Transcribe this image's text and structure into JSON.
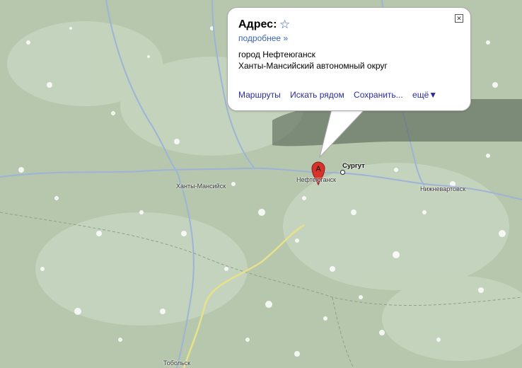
{
  "bubble": {
    "title": "Адрес:",
    "star_icon": "star-outline-icon",
    "more_link": "подробнее »",
    "address_line1": "город Нефтеюганск",
    "address_line2": "Ханты-Мансийский автономный округ",
    "links": [
      "Маршруты",
      "Искать рядом",
      "Сохранить...",
      "ещё▼"
    ],
    "close_icon": "close-icon"
  },
  "marker": {
    "label": "A",
    "color": "#d6332b"
  },
  "cities": {
    "khanty": "Ханты-Мансийск",
    "surgut": "Сургут",
    "nefte": "Нефтеюганск",
    "nizhnevartovsk": "Нижневартовск",
    "tobolsk": "Тобольск"
  },
  "colors": {
    "land": "#b9c9b0",
    "water": "#9fb3d6",
    "road": "#e7e18c",
    "snow": "#ffffff"
  }
}
